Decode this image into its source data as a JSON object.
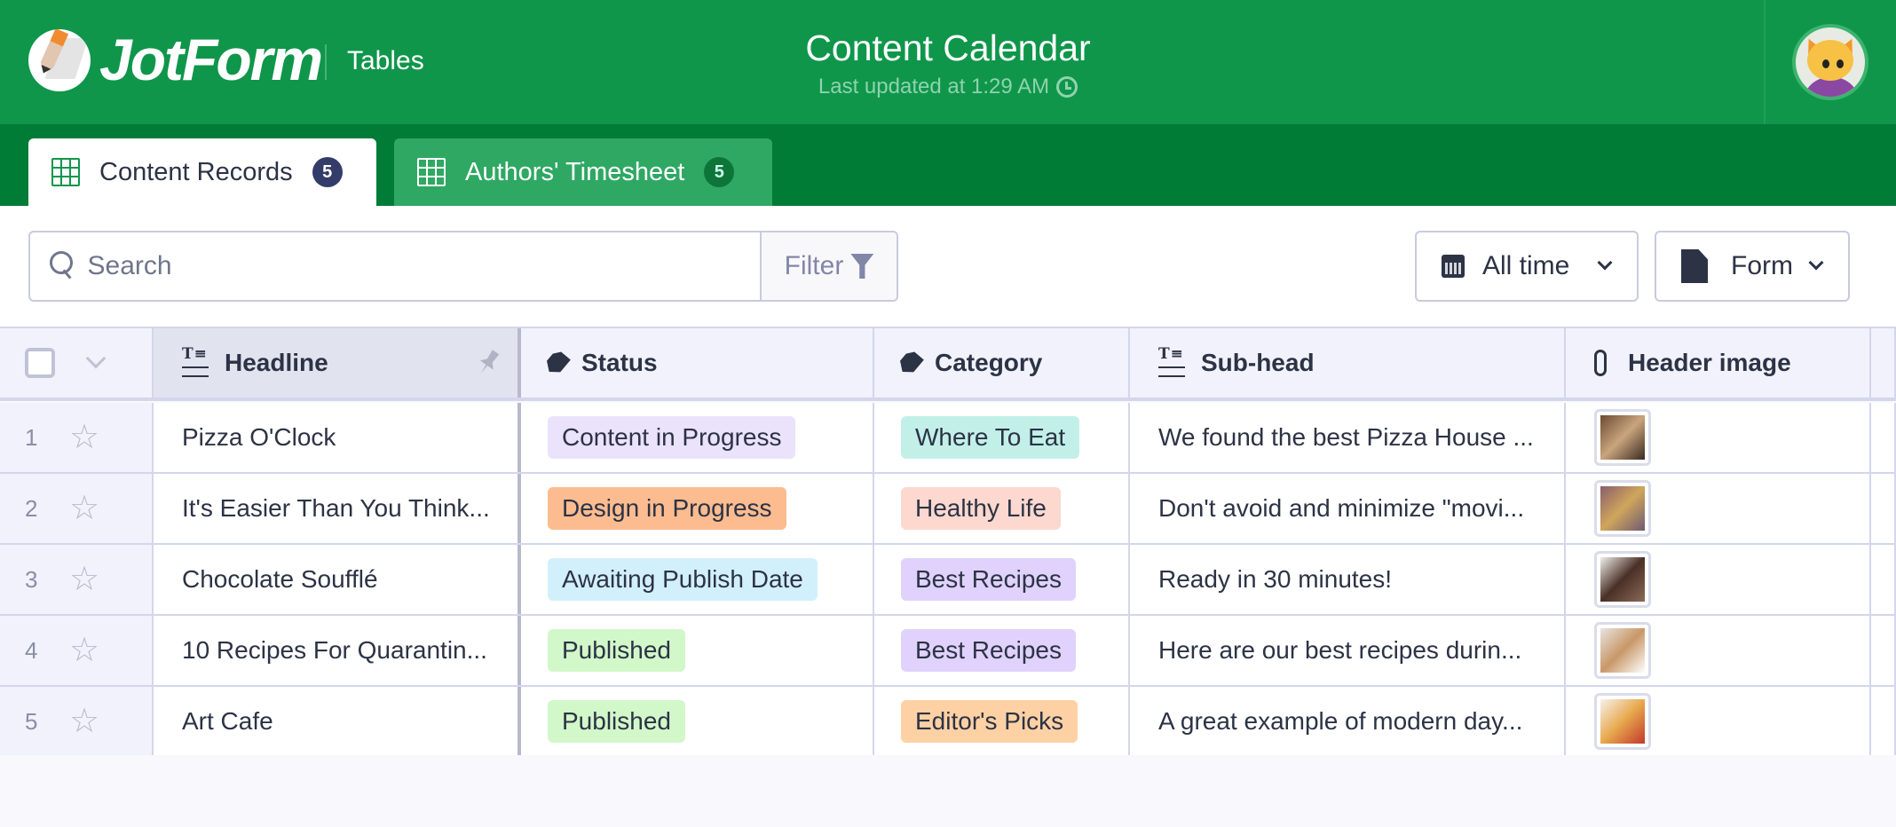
{
  "header": {
    "brand": "JotForm",
    "product": "Tables",
    "title": "Content Calendar",
    "last_updated": "Last updated at 1:29 AM",
    "colors": {
      "primary": "#0f964b",
      "tabbar": "#007c37"
    }
  },
  "tabs": [
    {
      "label": "Content Records",
      "count": "5",
      "active": true
    },
    {
      "label": "Authors' Timesheet",
      "count": "5",
      "active": false
    }
  ],
  "toolbar": {
    "search_placeholder": "Search",
    "search_value": "",
    "filter_label": "Filter",
    "time_range": "All time",
    "form_label": "Form"
  },
  "table": {
    "columns": [
      {
        "label": "Headline",
        "icon": "text-icon"
      },
      {
        "label": "Status",
        "icon": "tag-icon"
      },
      {
        "label": "Category",
        "icon": "tag-icon"
      },
      {
        "label": "Sub-head",
        "icon": "text-icon"
      },
      {
        "label": "Header image",
        "icon": "paperclip-icon"
      }
    ],
    "rows": [
      {
        "num": "1",
        "headline": "Pizza O'Clock",
        "status": "Content in Progress",
        "status_color": "#ebe2fb",
        "category": "Where To Eat",
        "category_color": "#c2f0e9",
        "subhead": "We found the best Pizza House ...",
        "image_colors": [
          "#6b4a32",
          "#c9a57e",
          "#3a2a20"
        ]
      },
      {
        "num": "2",
        "headline": "It's Easier Than You Think...",
        "status": "Design in Progress",
        "status_color": "#fdbc90",
        "category": "Healthy Life",
        "category_color": "#fdd8cf",
        "subhead": "Don't avoid and minimize \"movi...",
        "image_colors": [
          "#8a5e6a",
          "#d0a65c",
          "#6e5a72"
        ]
      },
      {
        "num": "3",
        "headline": "Chocolate Soufflé",
        "status": "Awaiting Publish Date",
        "status_color": "#d2f0fb",
        "category": "Best Recipes",
        "category_color": "#e0d2fd",
        "subhead": "Ready in 30 minutes!",
        "image_colors": [
          "#f0eeea",
          "#4a3026",
          "#8b6a58"
        ]
      },
      {
        "num": "4",
        "headline": "10 Recipes For Quarantin...",
        "status": "Published",
        "status_color": "#d2f7c9",
        "category": "Best Recipes",
        "category_color": "#e0d2fd",
        "subhead": "Here are our best recipes durin...",
        "image_colors": [
          "#e8e4df",
          "#c89868",
          "#ffffff"
        ]
      },
      {
        "num": "5",
        "headline": "Art Cafe",
        "status": "Published",
        "status_color": "#d2f7c9",
        "category": "Editor's Picks",
        "category_color": "#fed1a4",
        "subhead": "A great example of modern day...",
        "image_colors": [
          "#f6f2ee",
          "#e8a94e",
          "#c0392b"
        ]
      }
    ]
  }
}
